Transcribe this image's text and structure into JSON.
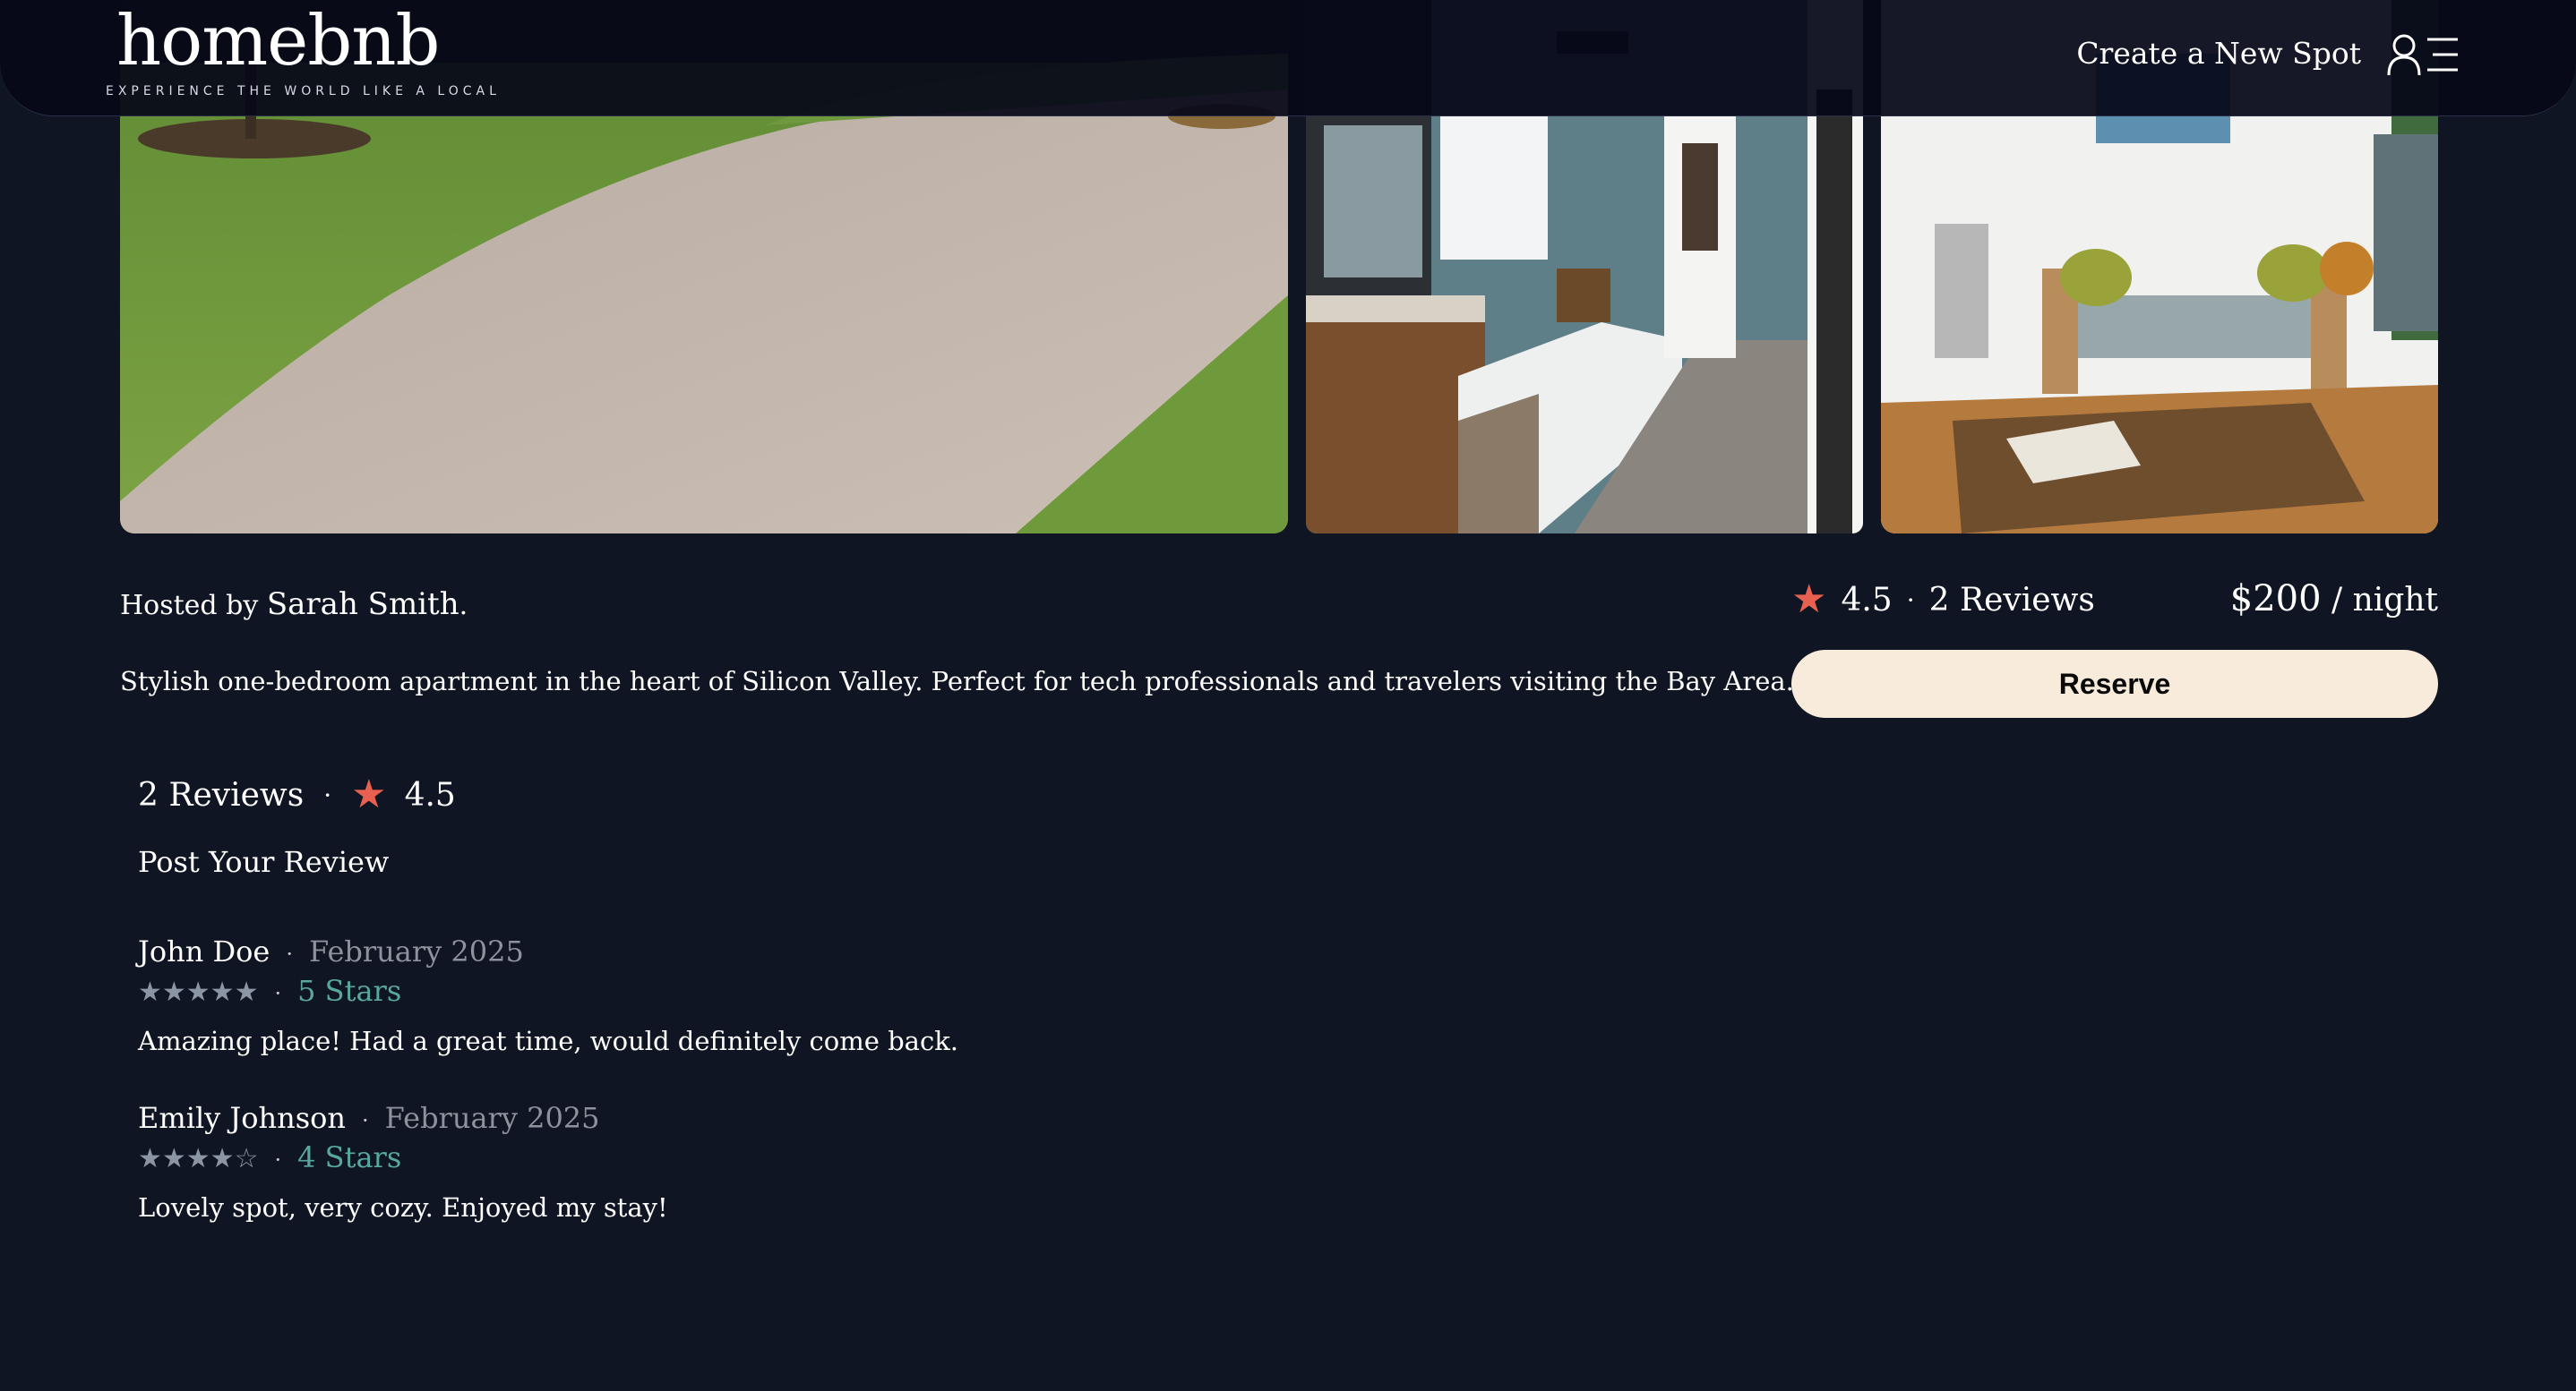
{
  "header": {
    "logo_word": "homebnb",
    "logo_tagline": "EXPERIENCE THE WORLD LIKE A LOCAL",
    "create_spot_label": "Create a New Spot",
    "user_menu_icon": "user-menu-icon"
  },
  "gallery": {
    "photos": [
      {
        "subject": "front yard driveway and lawn"
      },
      {
        "subject": "bathroom with tub and wood vanity"
      },
      {
        "subject": "living room with sofa and coffee table"
      }
    ]
  },
  "listing": {
    "hosted_prefix": "Hosted by ",
    "host_name": "Sarah Smith",
    "hosted_suffix": ".",
    "description": "Stylish one-bedroom apartment in the heart of Silicon Valley. Perfect for tech professionals and travelers visiting the Bay Area.",
    "rating": "4.5",
    "review_count_label": "2 Reviews",
    "price": "$200",
    "price_unit": " / night",
    "reserve_label": "Reserve",
    "star_icon": "star-icon",
    "star_color": "#e8604f"
  },
  "reviews": {
    "count_label": "2 Reviews",
    "rating": "4.5",
    "post_label": "Post Your Review",
    "items": [
      {
        "author": "John Doe",
        "date": "February 2025",
        "stars_glyphs": "★★★★★",
        "stars_label": "5 Stars",
        "stars": 5,
        "text": "Amazing place! Had a great time, would definitely come back."
      },
      {
        "author": "Emily Johnson",
        "date": "February 2025",
        "stars_glyphs": "★★★★☆",
        "stars_label": "4 Stars",
        "stars": 4,
        "text": "Lovely spot, very cozy. Enjoyed my stay!"
      }
    ]
  },
  "colors": {
    "background": "#0f1522",
    "header": "#060818",
    "reserve_bg": "#f8ebdb",
    "stars_label": "#59a8a0",
    "date_gray": "#8d929c"
  }
}
